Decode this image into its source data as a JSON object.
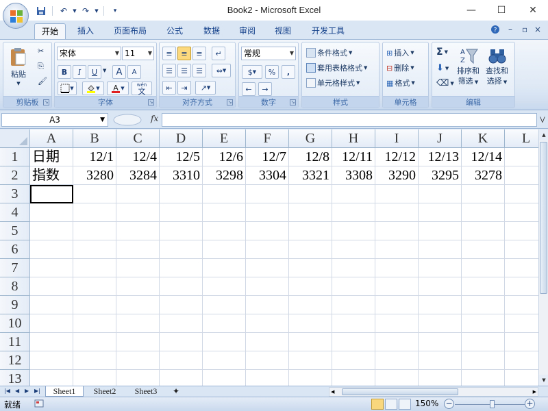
{
  "window": {
    "title": "Book2 - Microsoft Excel"
  },
  "tabs": [
    "开始",
    "插入",
    "页面布局",
    "公式",
    "数据",
    "审阅",
    "视图",
    "开发工具"
  ],
  "ribbon": {
    "clipboard": {
      "label": "剪贴板",
      "paste": "粘贴"
    },
    "font": {
      "label": "字体",
      "name": "宋体",
      "size": "11",
      "bold": "B",
      "italic": "I",
      "underline": "U",
      "grow": "A",
      "shrink": "A",
      "wen": "wén",
      "wen_char": "文"
    },
    "align": {
      "label": "对齐方式"
    },
    "number": {
      "label": "数字",
      "format": "常规",
      "percent": "%",
      "comma": ","
    },
    "styles": {
      "label": "样式",
      "conditional": "条件格式",
      "table": "套用表格格式",
      "cell": "单元格样式"
    },
    "cells": {
      "label": "单元格",
      "insert": "插入",
      "delete": "删除",
      "format": "格式"
    },
    "editing": {
      "label": "编辑",
      "sigma": "Σ",
      "sort1": "排序和",
      "sort2": "筛选",
      "find1": "查找和",
      "find2": "选择"
    }
  },
  "formula_bar": {
    "name_box": "A3",
    "fx": "fx",
    "value": ""
  },
  "columns": [
    "A",
    "B",
    "C",
    "D",
    "E",
    "F",
    "G",
    "H",
    "I",
    "J",
    "K",
    "L"
  ],
  "rows": [
    "1",
    "2",
    "3",
    "4",
    "5",
    "6",
    "7",
    "8",
    "9",
    "10",
    "11",
    "12",
    "13"
  ],
  "cells": {
    "row1": [
      "日期",
      "12/1",
      "12/4",
      "12/5",
      "12/6",
      "12/7",
      "12/8",
      "12/11",
      "12/12",
      "12/13",
      "12/14"
    ],
    "row2": [
      "指数",
      "3280",
      "3284",
      "3310",
      "3298",
      "3304",
      "3321",
      "3308",
      "3290",
      "3295",
      "3278"
    ]
  },
  "sheets": [
    "Sheet1",
    "Sheet2",
    "Sheet3"
  ],
  "active_sheet": "Sheet1",
  "status": {
    "ready": "就绪",
    "zoom": "150%",
    "zoom_out": "−",
    "zoom_in": "+"
  },
  "colors": {
    "accent": "#15428b",
    "grid_line": "#d0d7e5",
    "header_bg": "#e4ecf7"
  }
}
